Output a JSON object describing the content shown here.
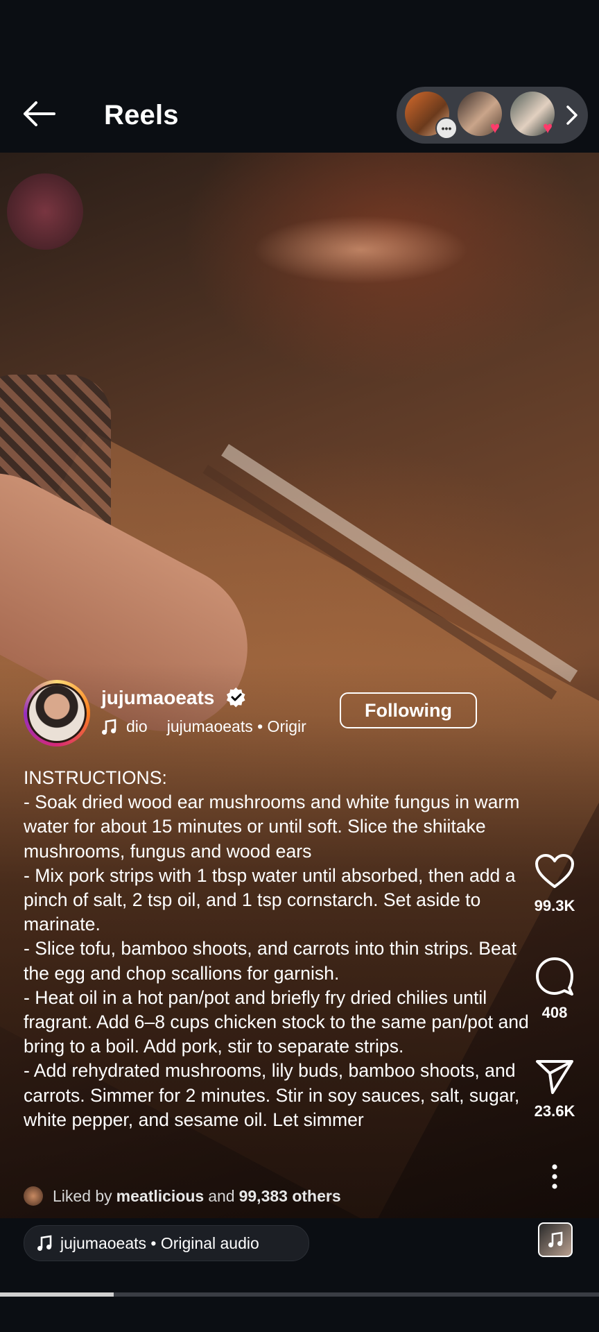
{
  "header": {
    "title": "Reels"
  },
  "friends": [
    {
      "badge": "comment"
    },
    {
      "badge": "heart"
    },
    {
      "badge": "heart"
    }
  ],
  "author": {
    "username": "jujumaoeats",
    "verified": true,
    "audio_short": "dio",
    "audio_label": "jujumaoeats • Origir",
    "follow_label": "Following"
  },
  "caption": "INSTRUCTIONS:\n- Soak dried wood ear mushrooms and white fungus in warm water for about 15 minutes or until soft. Slice the shiitake mushrooms, fungus and wood ears\n- Mix pork strips with 1 tbsp water until absorbed, then add a pinch of salt, 2 tsp oil, and 1 tsp cornstarch. Set aside to marinate.\n- Slice tofu, bamboo shoots, and carrots into thin strips. Beat the egg and chop scallions for garnish.\n- Heat oil in a hot pan/pot and briefly fry dried chilies until fragrant. Add 6–8 cups chicken stock to the same pan/pot and bring to a boil. Add pork, stir to separate strips.\n- Add rehydrated mushrooms, lily buds, bamboo shoots, and carrots. Simmer for 2 minutes. Stir in soy sauces, salt, sugar, white pepper, and sesame oil. Let simmer",
  "actions": {
    "likes": "99.3K",
    "comments": "408",
    "shares": "23.6K"
  },
  "liked_by": {
    "prefix": "Liked by",
    "user": "meatlicious",
    "middle": "and",
    "others": "99,383 others"
  },
  "bottom": {
    "audio": "jujumaoeats • Original audio",
    "progress": 0.19
  },
  "colors": {
    "background": "#0b0e13",
    "pill": "#3a3d44",
    "heart_badge": "#ff3b6b"
  }
}
